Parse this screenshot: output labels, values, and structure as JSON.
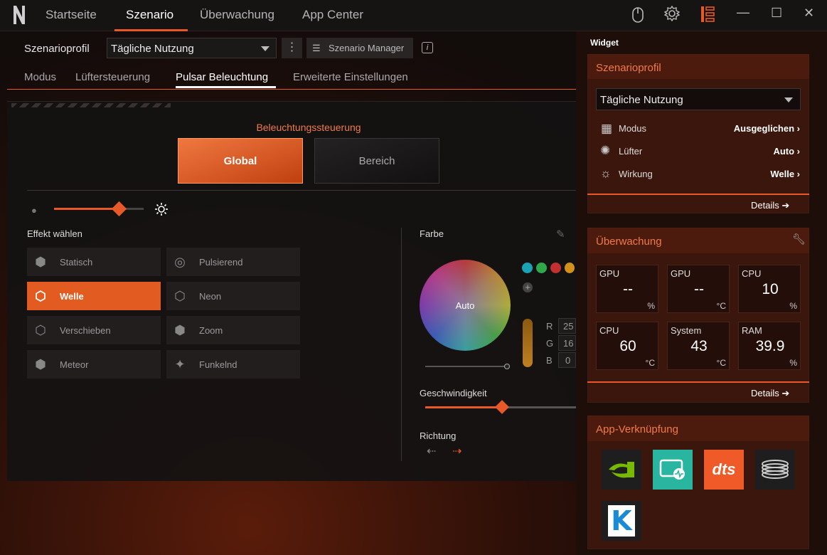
{
  "nav": {
    "tabs": [
      "Startseite",
      "Szenario",
      "Überwachung",
      "App Center"
    ],
    "active": 1
  },
  "profile": {
    "label": "Szenarioprofil",
    "value": "Tägliche Nutzung",
    "manager": "Szenario Manager"
  },
  "subtabs": [
    "Modus",
    "Lüftersteuerung",
    "Pulsar Beleuchtung",
    "Erweiterte Einstellungen"
  ],
  "lighting": {
    "title": "Beleuchtungssteuerung",
    "global": "Global",
    "bereich": "Bereich",
    "brightness": 0.73,
    "effect_title": "Effekt wählen",
    "effects": [
      {
        "name": "Statisch",
        "active": false
      },
      {
        "name": "Pulsierend",
        "active": false
      },
      {
        "name": "Welle",
        "active": true
      },
      {
        "name": "Neon",
        "active": false
      },
      {
        "name": "Verschieben",
        "active": false
      },
      {
        "name": "Zoom",
        "active": false
      },
      {
        "name": "Meteor",
        "active": false
      },
      {
        "name": "Funkelnd",
        "active": false
      }
    ],
    "color_title": "Farbe",
    "wheel_label": "Auto",
    "rgb": {
      "r_label": "R",
      "r": "25",
      "g_label": "G",
      "g": "16",
      "b_label": "B",
      "b": "0"
    },
    "swatches": [
      "#1aa3b5",
      "#2ea84a",
      "#c23030",
      "#d4901c"
    ],
    "speed_title": "Geschwindigkeit",
    "speed": 0.51,
    "direction_title": "Richtung"
  },
  "widget": {
    "title": "Widget",
    "scenario": {
      "title": "Szenarioprofil",
      "value": "Tägliche Nutzung",
      "rows": [
        {
          "label": "Modus",
          "value": "Ausgeglichen"
        },
        {
          "label": "Lüfter",
          "value": "Auto"
        },
        {
          "label": "Wirkung",
          "value": "Welle"
        }
      ],
      "details": "Details"
    },
    "monitor": {
      "title": "Überwachung",
      "details": "Details",
      "metrics": [
        {
          "label": "GPU",
          "value": "--",
          "unit": "%"
        },
        {
          "label": "GPU",
          "value": "--",
          "unit": "°C"
        },
        {
          "label": "CPU",
          "value": "10",
          "unit": "%"
        },
        {
          "label": "CPU",
          "value": "60",
          "unit": "°C"
        },
        {
          "label": "System",
          "value": "43",
          "unit": "°C"
        },
        {
          "label": "RAM",
          "value": "39.9",
          "unit": "%"
        }
      ]
    },
    "apps": {
      "title": "App-Verknüpfung",
      "items": [
        "nvidia-icon",
        "monitor-app-icon",
        "dts-logo",
        "coil-app-icon",
        "k-app-icon"
      ],
      "dts_text": "dts",
      "k_text": "K"
    }
  },
  "colors": {
    "accent": "#e8592a",
    "accent_text": "#f07a4a"
  }
}
